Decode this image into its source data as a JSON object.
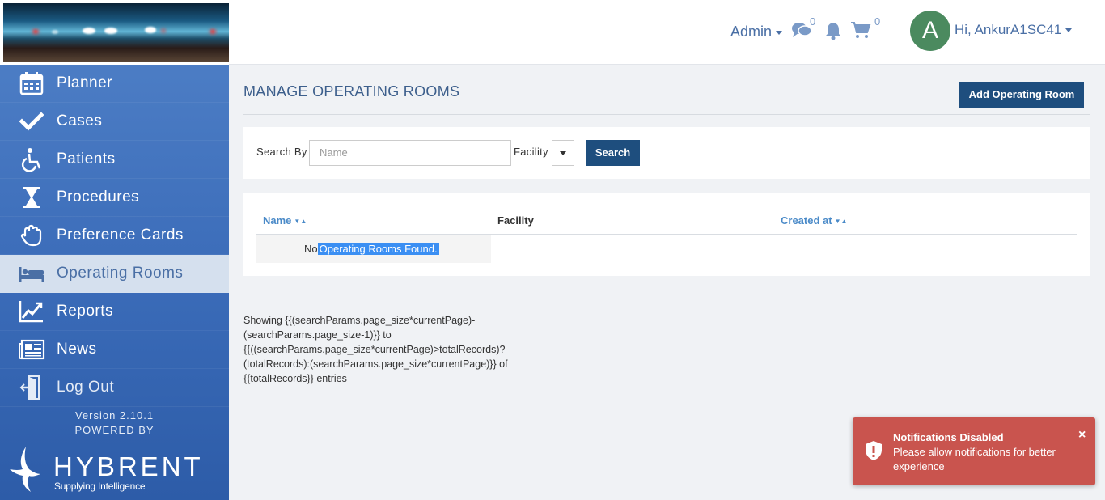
{
  "header": {
    "admin_label": "Admin",
    "messages_count": "0",
    "cart_count": "0",
    "avatar_initial": "A",
    "user_greeting": "Hi, AnkurA1SC41"
  },
  "sidebar": {
    "items": [
      {
        "label": "Planner",
        "icon": "calendar-icon"
      },
      {
        "label": "Cases",
        "icon": "check-icon"
      },
      {
        "label": "Patients",
        "icon": "wheelchair-icon"
      },
      {
        "label": "Procedures",
        "icon": "hourglass-icon"
      },
      {
        "label": "Preference Cards",
        "icon": "glove-icon"
      },
      {
        "label": "Operating Rooms",
        "icon": "bed-icon",
        "active": true
      },
      {
        "label": "Reports",
        "icon": "line-chart-icon"
      },
      {
        "label": "News",
        "icon": "newspaper-icon"
      },
      {
        "label": "Log Out",
        "icon": "door-exit-icon"
      }
    ],
    "version": "Version 2.10.1",
    "powered_by": "POWERED BY",
    "brand_name": "HYBRENT",
    "brand_tagline": "Supplying Intelligence"
  },
  "main": {
    "title": "MANAGE OPERATING ROOMS",
    "add_button": "Add Operating Room",
    "search": {
      "search_by_label": "Search By",
      "name_placeholder": "Name",
      "facility_label": "Facility",
      "search_button": "Search"
    },
    "table": {
      "columns": [
        "Name",
        "Facility",
        "Created at"
      ],
      "empty_prefix": "No",
      "empty_highlight": "Operating Rooms Found."
    },
    "pager_text": "Showing {{(searchParams.page_size*currentPage)-(searchParams.page_size-1)}} to {{((searchParams.page_size*currentPage)>totalRecords)?(totalRecords):(searchParams.page_size*currentPage)}} of {{totalRecords}} entries"
  },
  "toast": {
    "title": "Notifications Disabled",
    "message": "Please allow notifications for better experience",
    "close": "×"
  },
  "colors": {
    "sidebar": "#3b6cb9",
    "primary_button": "#1e4e7e",
    "toast": "#c9544e",
    "link": "#4a6fa5"
  }
}
